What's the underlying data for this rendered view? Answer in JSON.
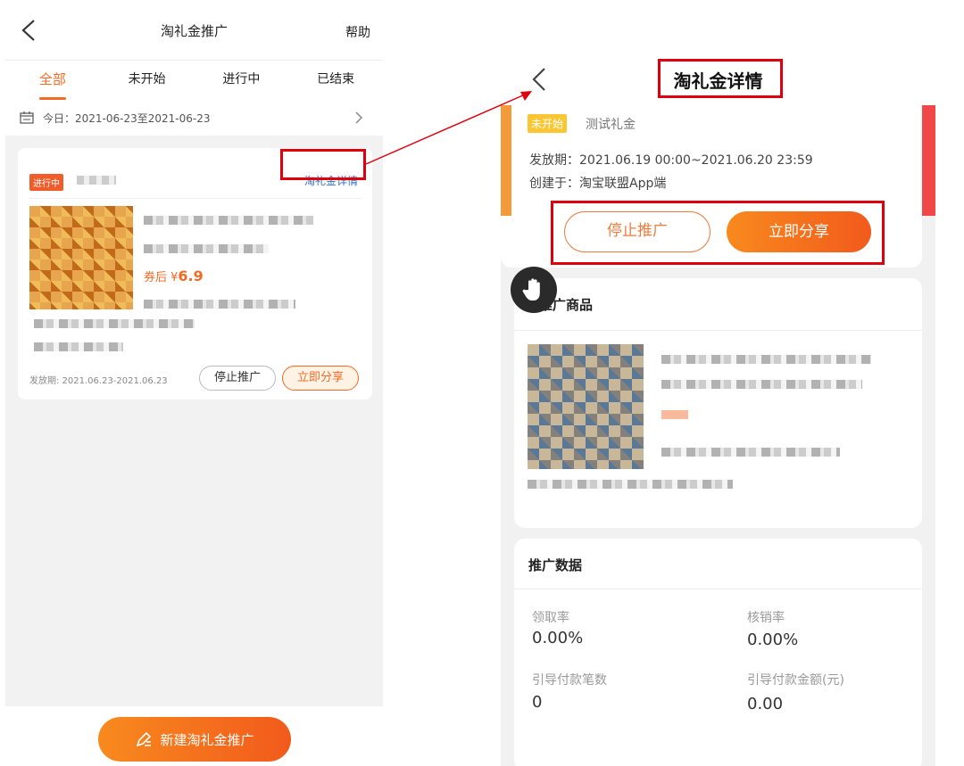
{
  "left": {
    "header": {
      "title": "淘礼金推广",
      "help": "帮助"
    },
    "tabs": [
      "全部",
      "未开始",
      "进行中",
      "已结束"
    ],
    "date_filter": "今日：2021-06-23至2021-06-23",
    "card": {
      "status": "进行中",
      "detail_link": "淘礼金详情",
      "price_prefix": "券后 ¥",
      "price_value": "6.9",
      "issue_period": "发放期: 2021.06.23-2021.06.23",
      "stop_button": "停止推广",
      "share_button": "立即分享"
    },
    "new_button": "新建淘礼金推广"
  },
  "right": {
    "header": {
      "title": "淘礼金详情"
    },
    "status_tag": "未开始",
    "gift_name": "测试礼金",
    "issue_period": "发放期：2021.06.19 00:00~2021.06.20 23:59",
    "created_on": "创建于：淘宝联盟App端",
    "stop_button": "停止推广",
    "share_button": "立即分享",
    "product_section_title": "推广商品",
    "stats_section_title": "推广数据",
    "stats": [
      {
        "label": "领取率",
        "value": "0.00%"
      },
      {
        "label": "核销率",
        "value": "0.00%"
      },
      {
        "label": "引导付款笔数",
        "value": "0"
      },
      {
        "label": "引导付款金额(元)",
        "value": "0.00"
      }
    ]
  },
  "colors": {
    "accent": "#f36a24",
    "annotation_red": "#e0000d",
    "link_blue": "#2d6fc3",
    "not_started_yellow": "#fbc634"
  },
  "icons": [
    "back-arrow-icon",
    "calendar-icon",
    "chevron-right-icon",
    "edit-icon",
    "hand-icon"
  ]
}
